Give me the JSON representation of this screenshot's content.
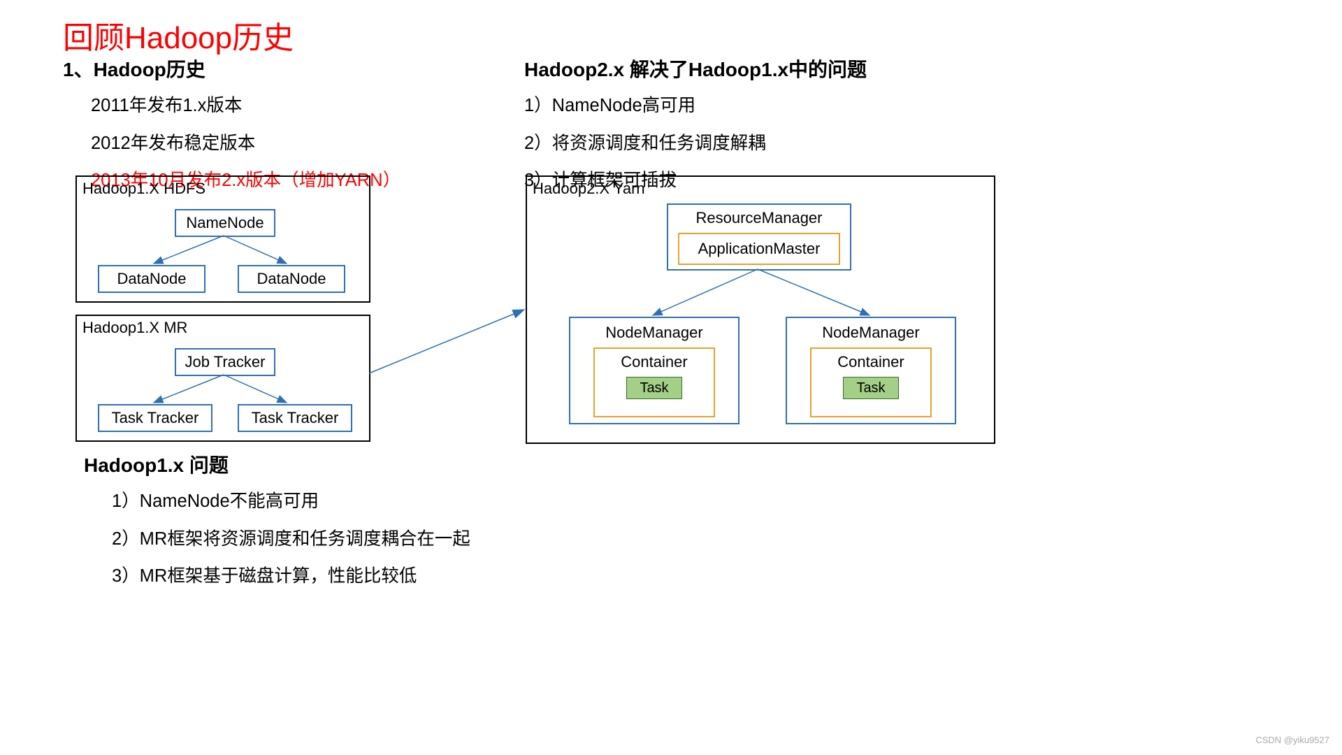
{
  "title": "回顾Hadoop历史",
  "left": {
    "heading": "1、Hadoop历史",
    "line1": "2011年发布1.x版本",
    "line2": "2012年发布稳定版本",
    "line3": "2013年10月发布2.x版本（增加YARN）"
  },
  "right": {
    "heading": "Hadoop2.x 解决了Hadoop1.x中的问题",
    "line1": "1）NameNode高可用",
    "line2": "2）将资源调度和任务调度解耦",
    "line3": "3）计算框架可插拔"
  },
  "problems": {
    "heading": "Hadoop1.x 问题",
    "line1": "1）NameNode不能高可用",
    "line2": "2）MR框架将资源调度和任务调度耦合在一起",
    "line3": "3）MR框架基于磁盘计算，性能比较低"
  },
  "hdfs": {
    "title": "Hadoop1.X HDFS",
    "namenode": "NameNode",
    "datanode1": "DataNode",
    "datanode2": "DataNode"
  },
  "mr": {
    "title": "Hadoop1.X MR",
    "jobtracker": "Job Tracker",
    "tasktracker1": "Task Tracker",
    "tasktracker2": "Task Tracker"
  },
  "yarn": {
    "title": "Hadoop2.X Yarn",
    "rm": "ResourceManager",
    "am": "ApplicationMaster",
    "nm": "NodeManager",
    "container": "Container",
    "task": "Task"
  },
  "watermark": "CSDN @yiku9527"
}
